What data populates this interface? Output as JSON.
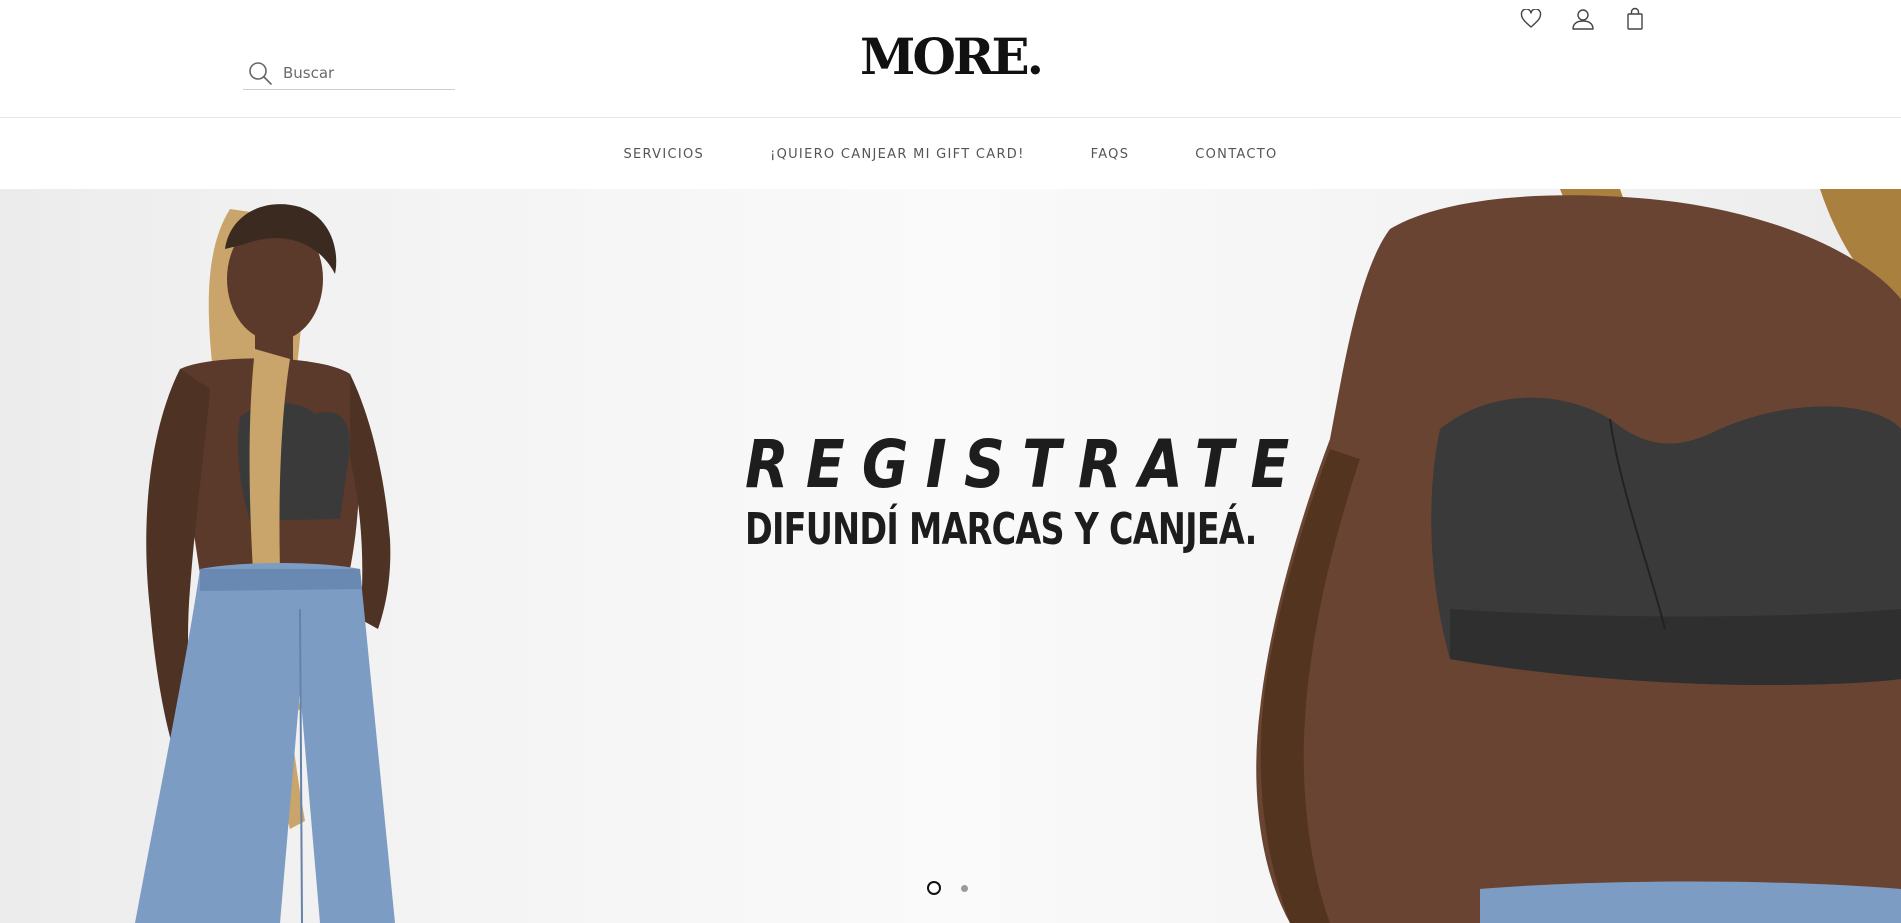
{
  "header": {
    "search": {
      "placeholder": "Buscar",
      "icon": "search-icon"
    },
    "logo": "MORE.",
    "icons": [
      "heart-icon",
      "user-icon",
      "shopping-bag-icon"
    ]
  },
  "nav": {
    "items": [
      {
        "label": "SERVICIOS"
      },
      {
        "label": "¡QUIERO CANJEAR MI GIFT CARD!"
      },
      {
        "label": "FAQS"
      },
      {
        "label": "CONTACTO"
      }
    ]
  },
  "hero": {
    "title": "REGISTRATE",
    "subtitle": "DIFUNDÍ MARCAS Y CANJEÁ.",
    "slides": {
      "count": 2,
      "active": 1
    }
  },
  "colors": {
    "text": "#1d1d1d",
    "nav_text": "#555555",
    "border": "#e6e6e6",
    "skin": "#5b3a2b",
    "denim": "#7d9cc4",
    "leather": "#3a3a3a",
    "braids": "#c9a56b"
  }
}
